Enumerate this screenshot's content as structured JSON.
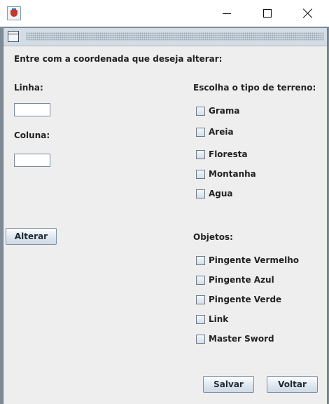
{
  "window": {
    "app_icon": "java-cup-icon",
    "controls": {
      "minimize": "minimize-icon",
      "maximize": "maximize-icon",
      "close": "close-icon"
    }
  },
  "frame": {
    "icon": "window-icon"
  },
  "form": {
    "instruction": "Entre com a coordenada que deseja alterar:",
    "linha_label": "Linha:",
    "linha_value": "",
    "coluna_label": "Coluna:",
    "coluna_value": "",
    "alterar_label": "Alterar"
  },
  "terrain": {
    "title": "Escolha o tipo de terreno:",
    "options": [
      {
        "label": "Grama",
        "checked": false
      },
      {
        "label": "Areia",
        "checked": false
      },
      {
        "label": "Floresta",
        "checked": false
      },
      {
        "label": "Montanha",
        "checked": false
      },
      {
        "label": "Agua",
        "checked": false
      }
    ]
  },
  "objects": {
    "title": "Objetos:",
    "options": [
      {
        "label": "Pingente Vermelho",
        "checked": false
      },
      {
        "label": "Pingente Azul",
        "checked": false
      },
      {
        "label": "Pingente Verde",
        "checked": false
      },
      {
        "label": "Link",
        "checked": false
      },
      {
        "label": "Master Sword",
        "checked": false
      }
    ]
  },
  "actions": {
    "salvar_label": "Salvar",
    "voltar_label": "Voltar"
  }
}
